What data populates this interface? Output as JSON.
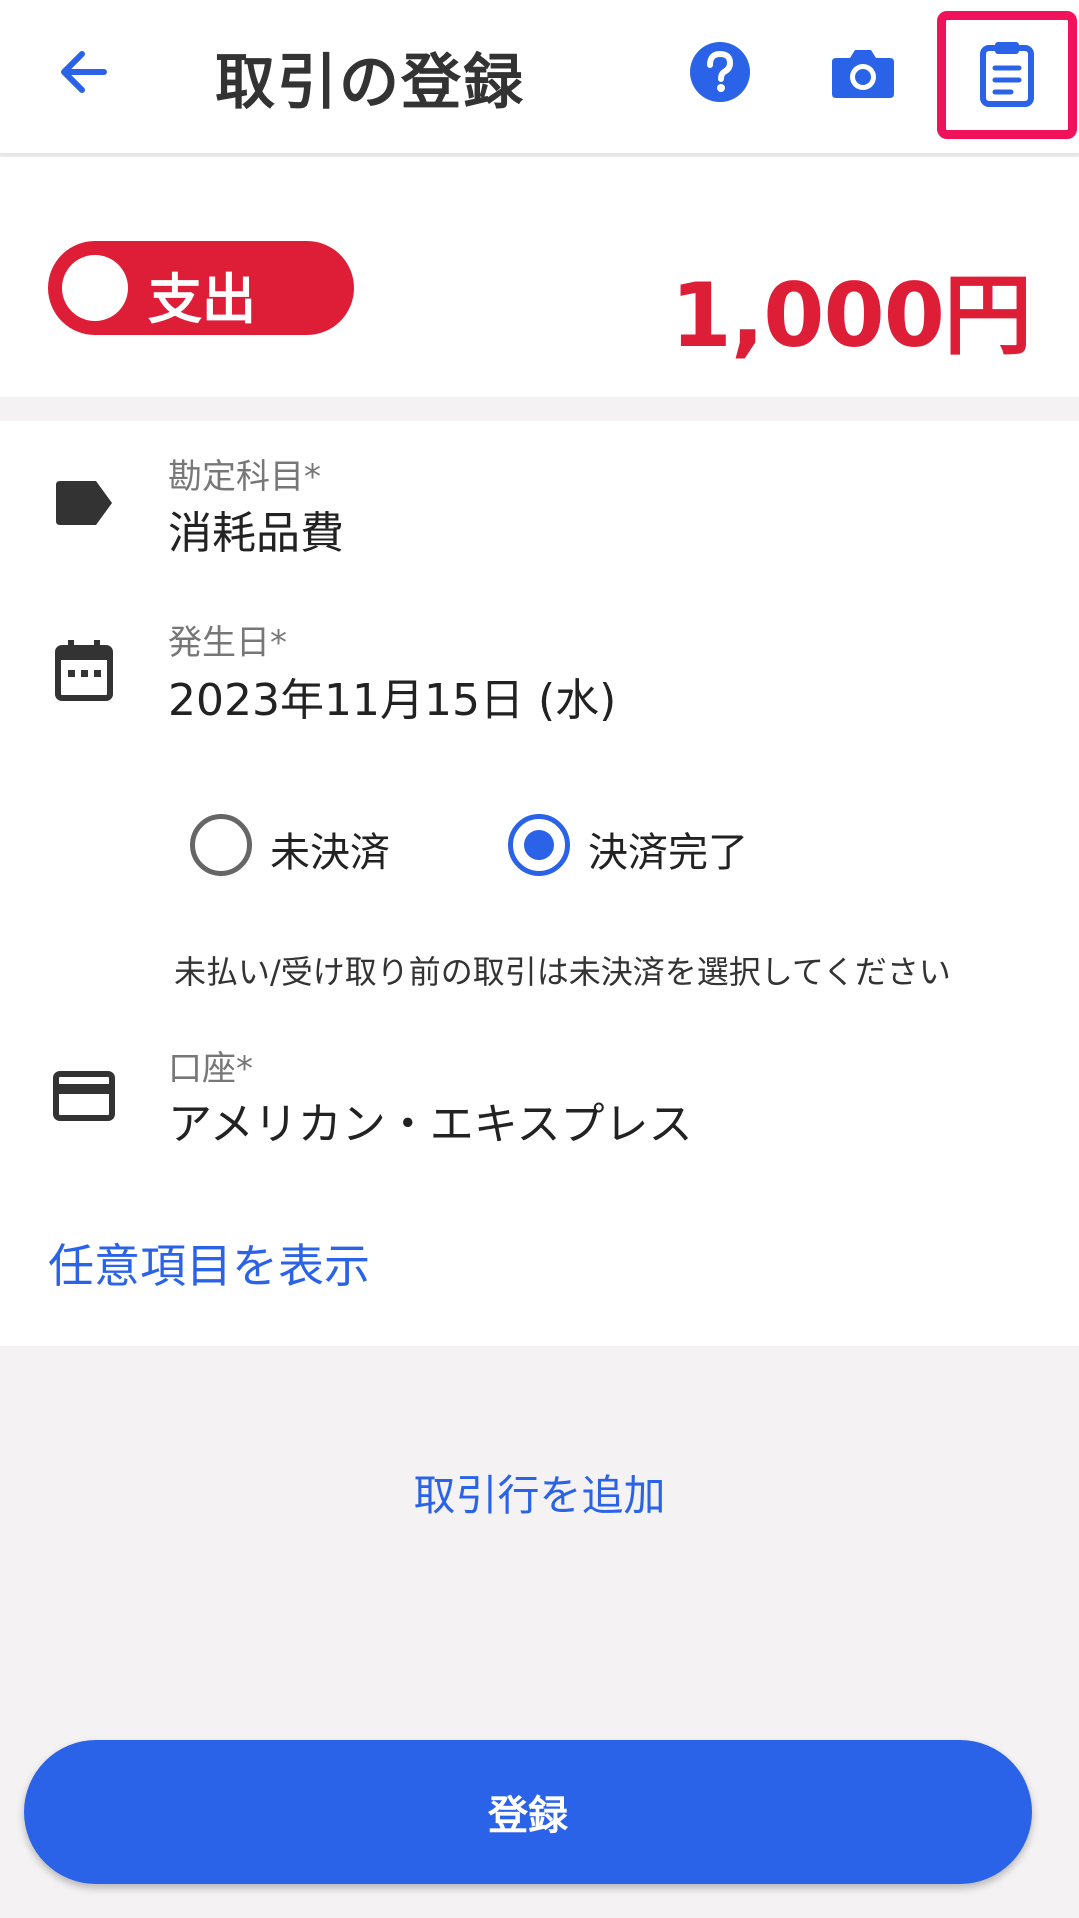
{
  "header": {
    "title": "取引の登録",
    "icons": [
      "arrow-left-icon",
      "help-circle-icon",
      "camera-icon",
      "clipboard-icon"
    ],
    "highlight_color": "#f0125a"
  },
  "transaction": {
    "type_label": "支出",
    "amount": "1,000円",
    "expense_color": "#dd1e36"
  },
  "fields": {
    "account_item": {
      "label": "勘定科目*",
      "value": "消耗品費"
    },
    "date": {
      "label": "発生日*",
      "value": "2023年11月15日 (水)"
    },
    "payment_status": {
      "options": [
        "未決済",
        "決済完了"
      ],
      "selected": "決済完了"
    },
    "hint": "未払い/受け取り前の取引は未決済を選択してください",
    "wallet": {
      "label": "口座*",
      "value": "アメリカン・エキスプレス"
    }
  },
  "links": {
    "show_optional": "任意項目を表示",
    "add_row": "取引行を追加"
  },
  "submit_label": "登録",
  "accent_color": "#2b63e8"
}
